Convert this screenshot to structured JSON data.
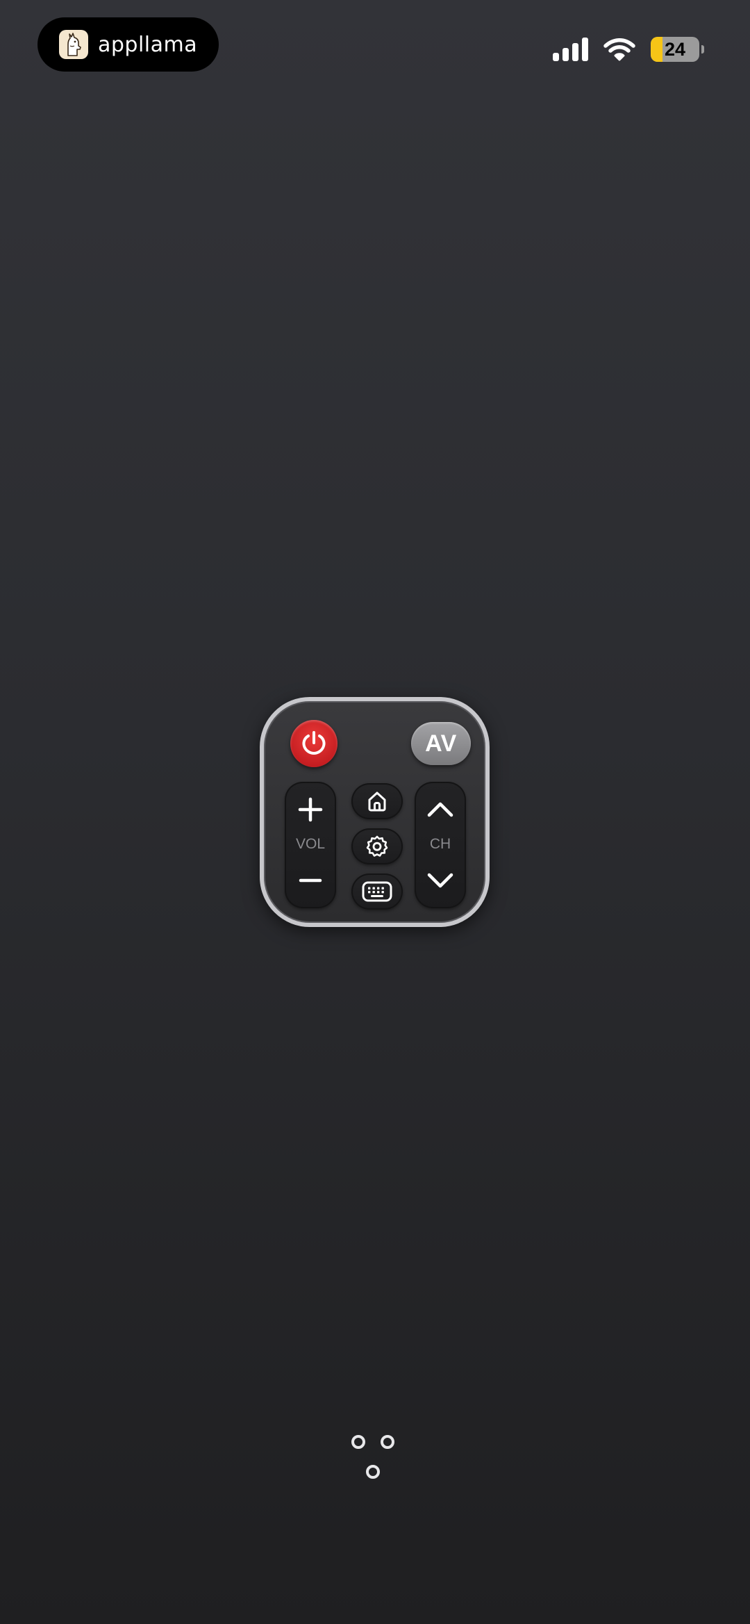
{
  "status_bar": {
    "brand_name": "appllama",
    "battery_level": "24",
    "battery_fraction": 0.24,
    "signal_bars": 4,
    "wifi": true
  },
  "remote": {
    "power_icon": "power-icon",
    "av_label": "AV",
    "volume": {
      "label": "VOL",
      "up_icon": "plus-icon",
      "down_icon": "minus-icon"
    },
    "channel": {
      "label": "CH",
      "up_icon": "chevron-up-icon",
      "down_icon": "chevron-down-icon"
    },
    "center_buttons": [
      "home-icon",
      "gear-icon",
      "keyboard-icon"
    ],
    "colors": {
      "power": "#d7272a",
      "av": "#8e8e91",
      "frame": "#c7c7cb"
    }
  },
  "background": {
    "top": "#323338",
    "bottom": "#1f1f21"
  }
}
